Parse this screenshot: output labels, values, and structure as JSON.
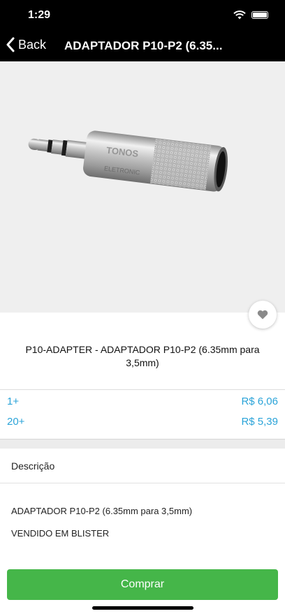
{
  "status": {
    "time": "1:29"
  },
  "nav": {
    "back_label": "Back",
    "title": "ADAPTADOR P10-P2 (6.35..."
  },
  "product": {
    "image_brand": "TONOS",
    "image_brand_sub": "ELETRONIC",
    "title": "P10-ADAPTER - ADAPTADOR P10-P2 (6.35mm para 3,5mm)"
  },
  "prices": [
    {
      "qty": "1+",
      "price": "R$ 6,06"
    },
    {
      "qty": "20+",
      "price": "R$ 5,39"
    }
  ],
  "description": {
    "header": "Descrição",
    "line1": "ADAPTADOR P10-P2 (6.35mm para 3,5mm)",
    "line2": "VENDIDO EM BLISTER"
  },
  "buy": {
    "label": "Comprar"
  },
  "colors": {
    "accent": "#2aa3d8",
    "buy": "#45b649",
    "bar": "#000000"
  }
}
